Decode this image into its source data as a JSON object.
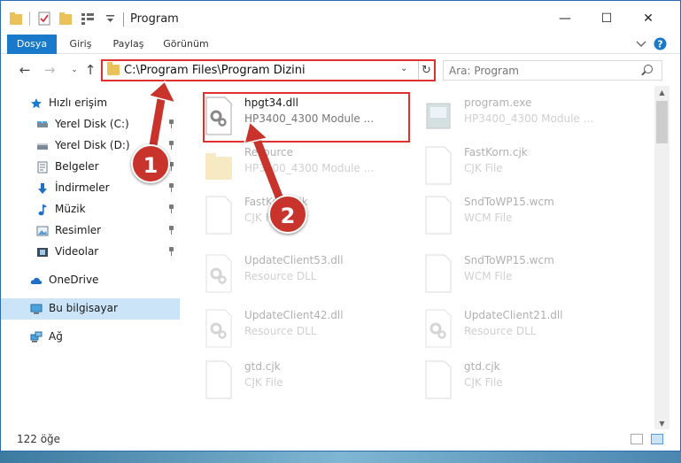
{
  "window": {
    "title": "Program"
  },
  "window_controls": {
    "minimize": "—",
    "maximize": "☐",
    "close": "✕"
  },
  "ribbon": {
    "tabs": [
      "Dosya",
      "Giriş",
      "Paylaş",
      "Görünüm"
    ]
  },
  "address": {
    "path": "C:\\Program Files\\Program Dizini",
    "search_placeholder": "Ara: Program"
  },
  "sidebar": {
    "items": [
      {
        "label": "Hızlı erişim",
        "icon": "star-icon",
        "pinned": false
      },
      {
        "label": "Yerel Disk (C:)",
        "icon": "drive-icon",
        "pinned": true
      },
      {
        "label": "Yerel Disk (D:)",
        "icon": "drive-icon",
        "pinned": true
      },
      {
        "label": "Belgeler",
        "icon": "documents-icon",
        "pinned": true
      },
      {
        "label": "İndirmeler",
        "icon": "download-icon",
        "pinned": true
      },
      {
        "label": "Müzik",
        "icon": "music-icon",
        "pinned": true
      },
      {
        "label": "Resimler",
        "icon": "pictures-icon",
        "pinned": true
      },
      {
        "label": "Videolar",
        "icon": "video-icon",
        "pinned": true
      },
      {
        "label": "OneDrive",
        "icon": "cloud-icon",
        "pinned": false
      },
      {
        "label": "Bu bilgisayar",
        "icon": "computer-icon",
        "pinned": false,
        "selected": true
      },
      {
        "label": "Ağ",
        "icon": "network-icon",
        "pinned": false
      }
    ]
  },
  "files": [
    {
      "name": "hpgt34.dll",
      "desc": "HP3400_4300 Module ...",
      "icon": "dll-gear-icon",
      "highlight": true
    },
    {
      "name": "program.exe",
      "desc": "HP3400_4300 Module ...",
      "icon": "exe-icon"
    },
    {
      "name": "Resource",
      "desc": "HP3400_4300 Module ...",
      "icon": "folder-icon"
    },
    {
      "name": "FastKorn.cjk",
      "desc": "CJK File",
      "icon": "blank-file-icon"
    },
    {
      "name": "FastKorn.cjk",
      "desc": "CJK File",
      "icon": "blank-file-icon"
    },
    {
      "name": "SndToWP15.wcm",
      "desc": "WCM File",
      "icon": "blank-file-icon"
    },
    {
      "name": "UpdateClient53.dll",
      "desc": "Resource DLL",
      "icon": "dll-gear-icon"
    },
    {
      "name": "SndToWP15.wcm",
      "desc": "WCM File",
      "icon": "blank-file-icon"
    },
    {
      "name": "UpdateClient42.dll",
      "desc": "Resource DLL",
      "icon": "dll-gear-icon"
    },
    {
      "name": "UpdateClient21.dll",
      "desc": "Resource DLL",
      "icon": "dll-gear-icon"
    },
    {
      "name": "gtd.cjk",
      "desc": "CJK File",
      "icon": "blank-file-icon"
    },
    {
      "name": "gtd.cjk",
      "desc": "CJK File",
      "icon": "blank-file-icon"
    }
  ],
  "status": {
    "count": "122 öğe"
  },
  "callouts": [
    "1",
    "2"
  ],
  "colors": {
    "accent": "#1979ca",
    "highlight": "#e03030",
    "selection": "#cce4f7",
    "badge": "#c8332c"
  }
}
